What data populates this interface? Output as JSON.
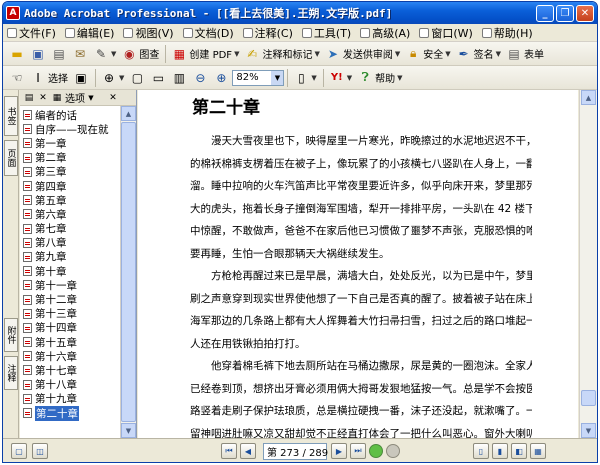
{
  "window": {
    "title": "Adobe Acrobat Professional - [[看上去很美].王朔.文字版.pdf]",
    "controls": [
      "_",
      "❐",
      "✕"
    ]
  },
  "menu": [
    {
      "label": "文件(F)"
    },
    {
      "label": "编辑(E)"
    },
    {
      "label": "视图(V)"
    },
    {
      "label": "文档(D)"
    },
    {
      "label": "注释(C)"
    },
    {
      "label": "工具(T)"
    },
    {
      "label": "高级(A)"
    },
    {
      "label": "窗口(W)"
    },
    {
      "label": "帮助(H)"
    }
  ],
  "toolbar1": {
    "search_label": "图查",
    "create_pdf_label": "创建 PDF",
    "comment_label": "注释和标记",
    "send_review_label": "发送供审阅",
    "security_label": "安全",
    "sign_label": "签名",
    "form_label": "表单"
  },
  "toolbar2": {
    "select_label": "选择",
    "zoom_value": "82%",
    "help_label": "帮助"
  },
  "nav_tabs": {
    "bookmarks": "书签",
    "pages": "页面",
    "attachments": "附件",
    "comments": "注释"
  },
  "panel": {
    "options_label": "选项"
  },
  "bookmarks": [
    {
      "label": "编者的话"
    },
    {
      "label": "自序——现在就"
    },
    {
      "label": "第一章"
    },
    {
      "label": "第二章"
    },
    {
      "label": "第三章"
    },
    {
      "label": "第四章"
    },
    {
      "label": "第五章"
    },
    {
      "label": "第六章"
    },
    {
      "label": "第七章"
    },
    {
      "label": "第八章"
    },
    {
      "label": "第九章"
    },
    {
      "label": "第十章"
    },
    {
      "label": "第十一章"
    },
    {
      "label": "第十二章"
    },
    {
      "label": "第十三章"
    },
    {
      "label": "第十四章"
    },
    {
      "label": "第十五章"
    },
    {
      "label": "第十六章"
    },
    {
      "label": "第十七章"
    },
    {
      "label": "第十八章"
    },
    {
      "label": "第十九章"
    },
    {
      "label": "第二十章"
    }
  ],
  "document": {
    "heading": "第二十章",
    "paragraphs": [
      [
        "漫天大雪夜里也下，映得屋里一片寒光，昨晚擦过的水泥地迟迟不干，刚找出来",
        "的棉袄棉裤支楞着压在被子上，像玩累了的小孩横七八竖趴在人身上，一翻身就往下出",
        "溜。睡中拉响的火车汽笛声比平常夜里要近许多，似乎向床开来，梦里那列车是一颗巨",
        "大的虎头，拖着长身子撞倒海军围墙，犁开一排排平房，一头趴在 42 楼下。方枪枪梦",
        "中惊醒，不敢做声，爸爸不在家后他已习惯做了噩梦不声张，克服恐惧的唯一办法是不",
        "要再睡，生怕一合眼那辆天大祸继续发生。"
      ],
      [
        "方枪枪再醒过来已是早晨，满墙大白，处处反光，以为已是中午，梦里那奇怪的刷",
        "刷之声意穿到现实世界使他想了一下自己是否真的醒了。披着被子站在床上往窗外看，",
        "海军那边的几条路上都有大人挥舞着大竹扫帚扫雪，扫过之后的路口堆起一些雪人，有",
        "人还在用铁锹拍拍打打。"
      ],
      [
        "他穿着棉毛裤下地去厕所站在马桶边撒尿，尿是黄的一圈泡沫。全家人合用的牙膏",
        "已经卷到顶，想挤出牙膏必须用俩大拇哥发狠地猛按一气。总是学不会按医生建议顺纹",
        "路竖着走刷子保护珐琅质，总是横拉硬拽一番，沫子还没起，就漱嘴了。一口牙膏水不",
        "留神咽进肚嘛又凉又甜却觉不正经直打体会了一把什么叫恶心。窗外大喇叭和屋里大"
      ]
    ]
  },
  "status": {
    "page_display": "第 273 / 289 页"
  }
}
